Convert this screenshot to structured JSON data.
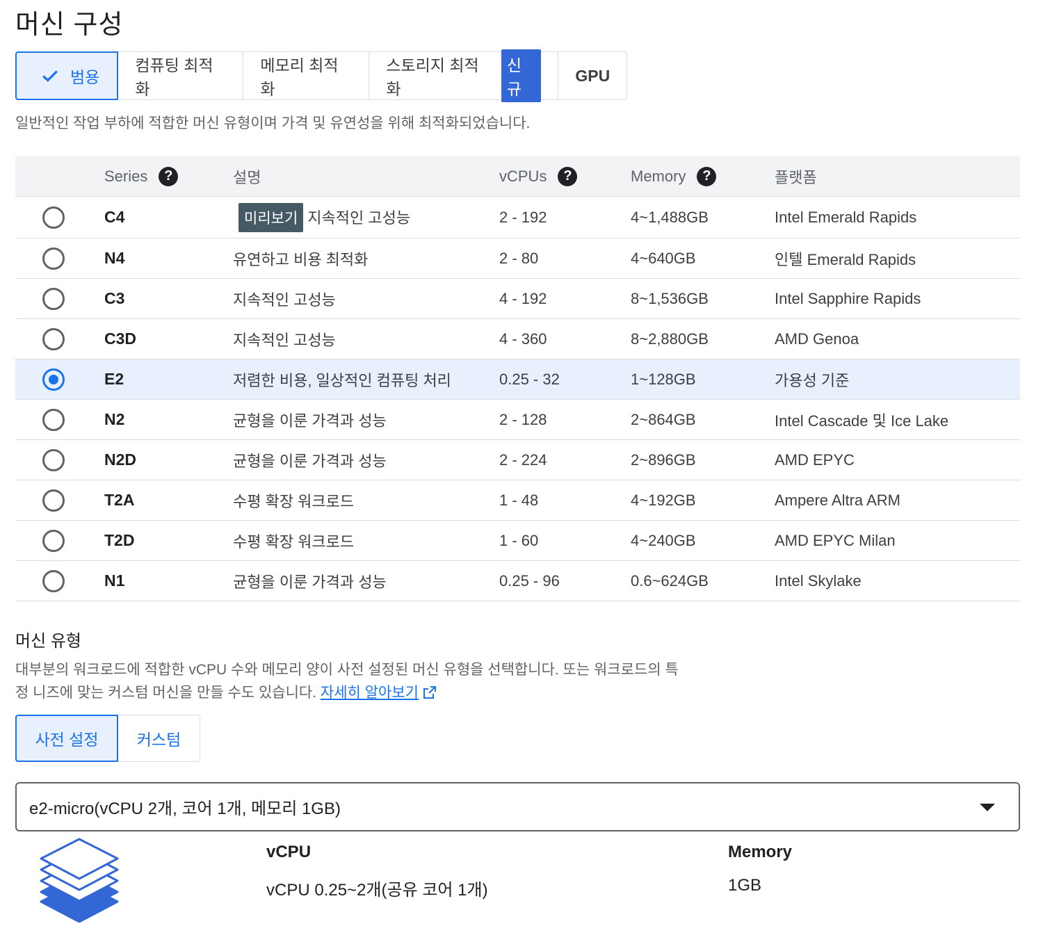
{
  "page_title": "머신 구성",
  "family_tabs": [
    {
      "label": "범용",
      "selected": true
    },
    {
      "label": "컴퓨팅 최적화"
    },
    {
      "label": "메모리 최적화"
    },
    {
      "label": "스토리지 최적화",
      "badge": "신규"
    },
    {
      "label": "GPU"
    }
  ],
  "family_description": "일반적인 작업 부하에 적합한 머신 유형이며 가격 및 유연성을 위해 최적화되었습니다.",
  "table": {
    "headers": {
      "series": "Series",
      "description": "설명",
      "vcpus": "vCPUs",
      "memory": "Memory",
      "platform": "플랫폼"
    },
    "help_glyph": "?",
    "preview_badge": "미리보기",
    "rows": [
      {
        "series": "C4",
        "description": "지속적인 고성능",
        "vcpus": "2 - 192",
        "memory": "4~1,488GB",
        "platform": "Intel Emerald Rapids",
        "preview": true
      },
      {
        "series": "N4",
        "description": "유연하고 비용 최적화",
        "vcpus": "2 - 80",
        "memory": "4~640GB",
        "platform": "인텔 Emerald Rapids"
      },
      {
        "series": "C3",
        "description": "지속적인 고성능",
        "vcpus": "4 - 192",
        "memory": "8~1,536GB",
        "platform": "Intel Sapphire Rapids"
      },
      {
        "series": "C3D",
        "description": "지속적인 고성능",
        "vcpus": "4 - 360",
        "memory": "8~2,880GB",
        "platform": "AMD Genoa"
      },
      {
        "series": "E2",
        "description": "저렴한 비용, 일상적인 컴퓨팅 처리",
        "vcpus": "0.25 - 32",
        "memory": "1~128GB",
        "platform": "가용성 기준",
        "selected": true
      },
      {
        "series": "N2",
        "description": "균형을 이룬 가격과 성능",
        "vcpus": "2 - 128",
        "memory": "2~864GB",
        "platform": "Intel Cascade 및 Ice Lake"
      },
      {
        "series": "N2D",
        "description": "균형을 이룬 가격과 성능",
        "vcpus": "2 - 224",
        "memory": "2~896GB",
        "platform": "AMD EPYC"
      },
      {
        "series": "T2A",
        "description": "수평 확장 워크로드",
        "vcpus": "1 - 48",
        "memory": "4~192GB",
        "platform": "Ampere Altra ARM"
      },
      {
        "series": "T2D",
        "description": "수평 확장 워크로드",
        "vcpus": "1 - 60",
        "memory": "4~240GB",
        "platform": "AMD EPYC Milan"
      },
      {
        "series": "N1",
        "description": "균형을 이룬 가격과 성능",
        "vcpus": "0.25 - 96",
        "memory": "0.6~624GB",
        "platform": "Intel Skylake"
      }
    ]
  },
  "machine_type": {
    "title": "머신 유형",
    "description_line1": "대부분의 워크로드에 적합한 vCPU 수와 메모리 양이 사전 설정된 머신 유형을 선택합니다. 또는 워크로드의 특",
    "description_line2": "정 니즈에 맞는 커스텀 머신을 만들 수도 있습니다.",
    "learn_more": "자세히 알아보기",
    "tabs": {
      "preset": "사전 설정",
      "custom": "커스텀"
    },
    "selected_type": "e2-micro(vCPU 2개, 코어 1개, 메모리 1GB)",
    "specs": {
      "vcpu_label": "vCPU",
      "vcpu_value": "vCPU 0.25~2개(공유 코어 1개)",
      "memory_label": "Memory",
      "memory_value": "1GB"
    }
  },
  "colors": {
    "accent": "#1a73e8",
    "selected_bg": "#e8f0fe",
    "badge_new": "#3367d6",
    "badge_preview": "#455a64"
  }
}
